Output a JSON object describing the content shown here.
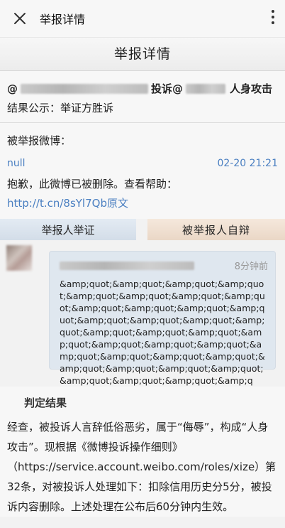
{
  "topbar": {
    "title": "举报详情"
  },
  "page_heading": "举报详情",
  "report": {
    "prefix": "@",
    "complaint_label": "投诉@",
    "complaint_type": "人身攻击",
    "result_label": "结果公示：",
    "result_value": "举证方胜诉"
  },
  "weibo": {
    "label": "被举报微博：",
    "user": "null",
    "time": "02-20 21:21",
    "message": "抱歉，此微博已被删除。查看帮助：",
    "link": "http://t.cn/8sYl7Qb原文"
  },
  "tabs": {
    "reporter": "举报人举证",
    "reported": "被举报人自辩"
  },
  "evidence": {
    "time": "8分钟前",
    "text": "&amp;quot;&amp;quot;&amp;quot;&amp;quot;&amp;quot;&amp;quot;&amp;quot;&amp;quot;&amp;quot;&amp;quot;&amp;quot;&amp;quot;&amp;quot;&amp;quot;&amp;quot;&amp;quot;&amp;quot;&amp;quot;&amp;quot;&amp;quot;&amp;quot;&amp;quot;&amp;quot;&amp;quot;&amp;quot;&amp;quot;&amp;quot;&amp;quot;&amp;quot;&amp;quot;&amp;quot;&amp;quot;&amp;quot;&amp;quot;&amp;q"
  },
  "judgement": {
    "title": "判定结果",
    "text": "经查，被投诉人言辞低俗恶劣，属于“侮辱”，构成“人身攻击”。现根据《微博投诉操作细则》（https://service.account.weibo.com/roles/xize）第32条，对被投诉人处理如下：扣除信用历史分5分，被投诉内容删除。上述处理在公布后60分钟内生效。"
  }
}
